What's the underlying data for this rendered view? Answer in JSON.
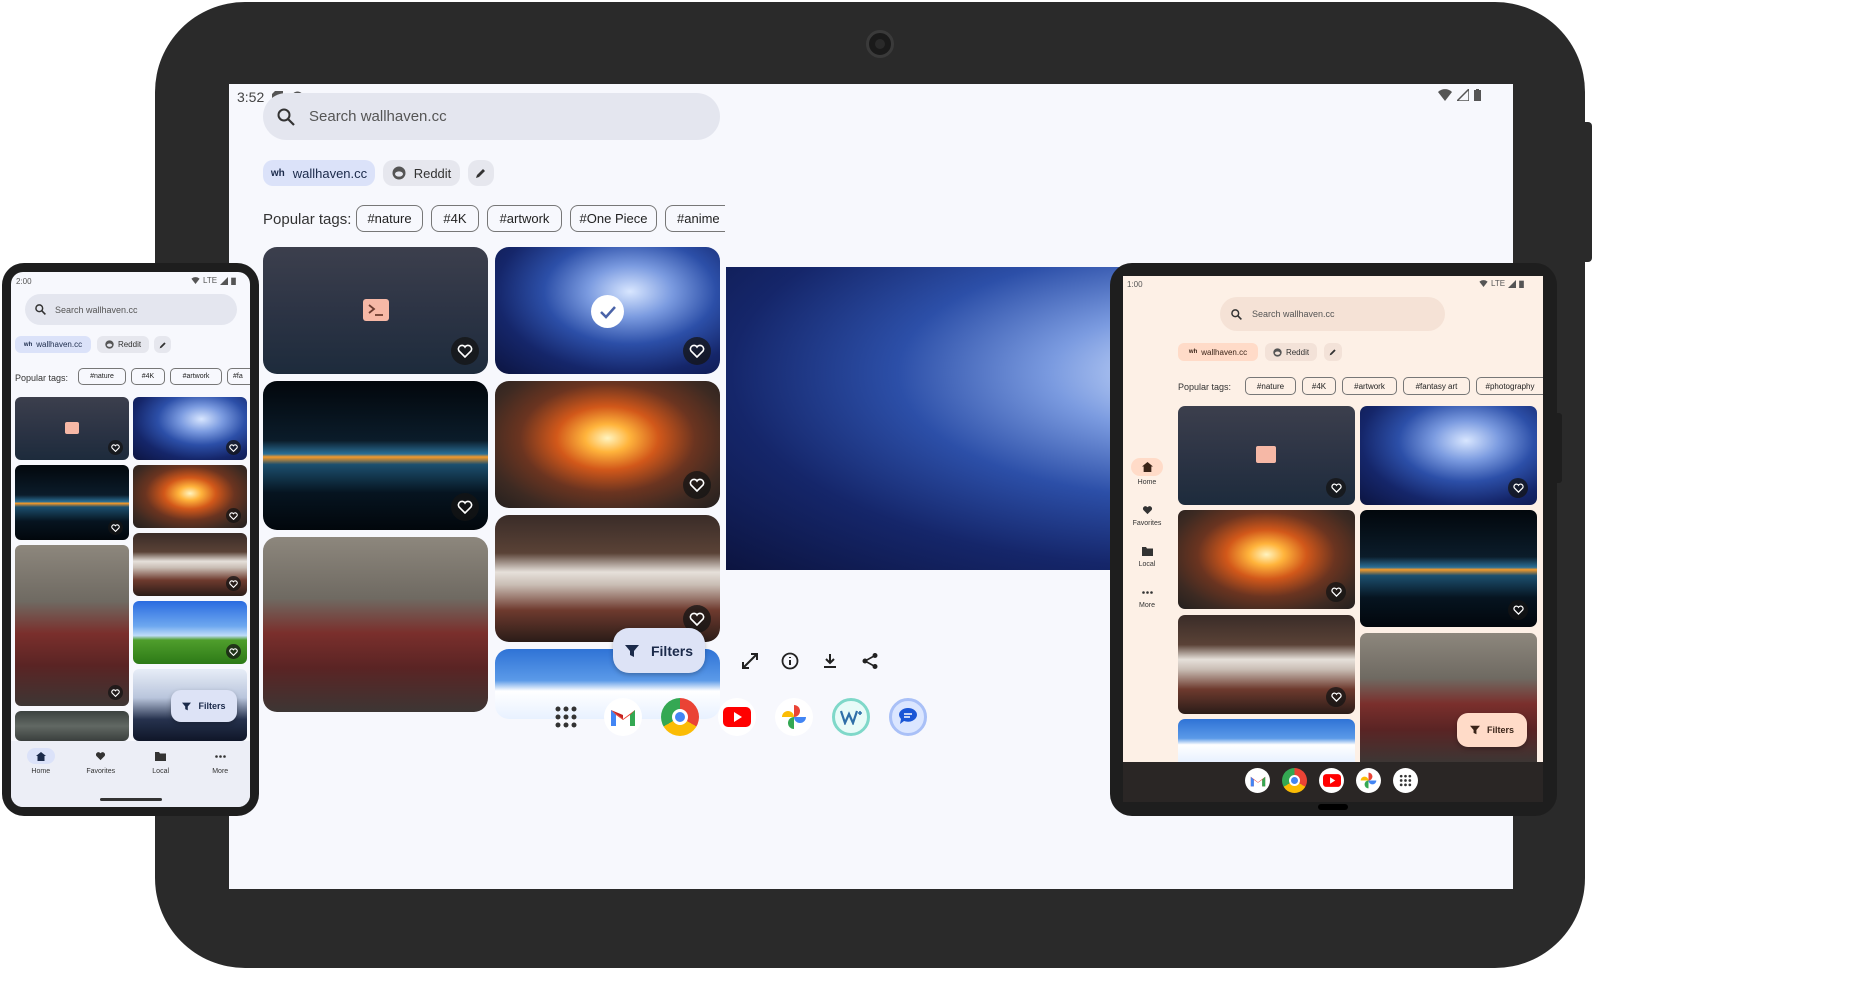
{
  "tablet": {
    "status": {
      "time": "3:52"
    },
    "search": {
      "placeholder": "Search wallhaven.cc"
    },
    "sources": [
      {
        "badge": "wh",
        "label": "wallhaven.cc"
      },
      {
        "label": "Reddit"
      }
    ],
    "popular_label": "Popular tags:",
    "tags": [
      "#nature",
      "#4K",
      "#artwork",
      "#One Piece",
      "#anime"
    ],
    "filters_label": "Filters",
    "detail_actions": [
      "fullscreen-icon",
      "info-icon",
      "download-icon",
      "share-icon"
    ],
    "dock_apps": [
      "apps-grid",
      "gmail",
      "chrome",
      "youtube",
      "photos",
      "wallhaven-app",
      "messages"
    ]
  },
  "phone": {
    "status": {
      "time": "2:00",
      "network": "LTE"
    },
    "search": {
      "placeholder": "Search wallhaven.cc"
    },
    "sources": [
      {
        "badge": "wh",
        "label": "wallhaven.cc"
      },
      {
        "label": "Reddit"
      }
    ],
    "popular_label": "Popular tags:",
    "tags": [
      "#nature",
      "#4K",
      "#artwork",
      "#fa"
    ],
    "filters_label": "Filters",
    "nav": [
      {
        "label": "Home",
        "icon": "home-icon"
      },
      {
        "label": "Favorites",
        "icon": "heart-icon"
      },
      {
        "label": "Local",
        "icon": "folder-icon"
      },
      {
        "label": "More",
        "icon": "more-icon"
      }
    ]
  },
  "fold": {
    "status": {
      "time": "1:00",
      "network": "LTE"
    },
    "search": {
      "placeholder": "Search wallhaven.cc"
    },
    "sources": [
      {
        "badge": "wh",
        "label": "wallhaven.cc"
      },
      {
        "label": "Reddit"
      }
    ],
    "popular_label": "Popular tags:",
    "tags": [
      "#nature",
      "#4K",
      "#artwork",
      "#fantasy art",
      "#photography"
    ],
    "filters_label": "Filters",
    "nav": [
      {
        "label": "Home",
        "icon": "home-icon"
      },
      {
        "label": "Favorites",
        "icon": "heart-icon"
      },
      {
        "label": "Local",
        "icon": "folder-icon"
      },
      {
        "label": "More",
        "icon": "more-icon"
      }
    ],
    "dock_apps": [
      "gmail",
      "chrome",
      "youtube",
      "photos",
      "apps-grid"
    ]
  },
  "colors": {
    "accent_blue": "#dbe2f9",
    "fold_accent": "#ffdbc8",
    "screen_bg": "#f7f8fd"
  }
}
